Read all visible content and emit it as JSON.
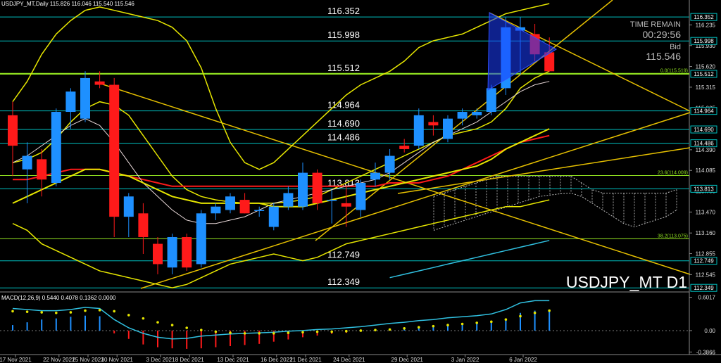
{
  "header": "USDJPY_MT,Daily  115.826 116.046 115.540 115.546",
  "macd_header": "MACD(12,26,9) 0.5440 0.4078 0.1362 0.0000",
  "panel": {
    "time_label": "TIME REMAIN",
    "time_value": "00:29:56",
    "bid_label": "Bid",
    "bid_value": "115.546"
  },
  "symbol_label": "USDJPY_MT D1",
  "colors": {
    "bull": "#1e90ff",
    "bear": "#ff1a1a",
    "hline": "#00c0c0",
    "price_box": "#00c0c0",
    "bollinger": "#e6e600",
    "ma_red": "#ff1a1a",
    "ma_white": "#e8d8d8",
    "trendline": "#e6c000",
    "fib": "#90e020"
  },
  "chart_data": {
    "type": "candlestick",
    "y_range": [
      112.32,
      116.52
    ],
    "price_axis_ticks": [
      "116.235",
      "115.930",
      "115.620",
      "115.315",
      "115.005",
      "114.390",
      "114.085",
      "113.780",
      "113.470",
      "113.160",
      "112.855",
      "112.545"
    ],
    "x_tick_labels": [
      "17 Nov 2021",
      "22 Nov 2021",
      "25 Nov 2021",
      "30 Nov 2021",
      "3 Dec 2021",
      "8 Dec 2021",
      "13 Dec 2021",
      "16 Dec 2021",
      "21 Dec 2021",
      "24 Dec 2021",
      "29 Dec 2021",
      "3 Jan 2022",
      "6 Jan 2022"
    ],
    "horizontal_levels": [
      {
        "price": 116.352,
        "label": "116.352"
      },
      {
        "price": 115.998,
        "label": "115.998"
      },
      {
        "price": 115.512,
        "label": "115.512"
      },
      {
        "price": 114.964,
        "label": "114.964"
      },
      {
        "price": 114.69,
        "label": "114.690"
      },
      {
        "price": 114.486,
        "label": "114.486"
      },
      {
        "price": 113.813,
        "label": "113.813"
      },
      {
        "price": 112.749,
        "label": "112.749"
      },
      {
        "price": 112.349,
        "label": "112.349"
      }
    ],
    "fib_levels": [
      {
        "price": 115.519,
        "label": "0.0(115.519)"
      },
      {
        "price": 114.009,
        "label": "23.6(114.009)"
      },
      {
        "price": 113.075,
        "label": "38.2(113.075)"
      }
    ],
    "candles": [
      {
        "o": 114.9,
        "h": 115.1,
        "l": 114.0,
        "c": 114.45
      },
      {
        "o": 114.1,
        "h": 114.5,
        "l": 113.6,
        "c": 114.3
      },
      {
        "o": 114.25,
        "h": 114.4,
        "l": 113.7,
        "c": 113.95
      },
      {
        "o": 113.9,
        "h": 115.0,
        "l": 113.85,
        "c": 114.95
      },
      {
        "o": 114.95,
        "h": 115.3,
        "l": 114.7,
        "c": 115.25
      },
      {
        "o": 114.85,
        "h": 115.55,
        "l": 114.8,
        "c": 115.45
      },
      {
        "o": 115.4,
        "h": 115.55,
        "l": 115.3,
        "c": 115.35
      },
      {
        "o": 115.35,
        "h": 115.45,
        "l": 113.1,
        "c": 113.4
      },
      {
        "o": 113.4,
        "h": 113.75,
        "l": 113.1,
        "c": 113.7
      },
      {
        "o": 113.45,
        "h": 113.6,
        "l": 112.85,
        "c": 113.1
      },
      {
        "o": 113.0,
        "h": 113.1,
        "l": 112.55,
        "c": 112.7
      },
      {
        "o": 112.65,
        "h": 113.15,
        "l": 112.55,
        "c": 113.1
      },
      {
        "o": 113.1,
        "h": 113.15,
        "l": 112.6,
        "c": 112.65
      },
      {
        "o": 112.7,
        "h": 113.5,
        "l": 112.65,
        "c": 113.45
      },
      {
        "o": 113.45,
        "h": 113.6,
        "l": 113.35,
        "c": 113.55
      },
      {
        "o": 113.5,
        "h": 113.75,
        "l": 113.45,
        "c": 113.7
      },
      {
        "o": 113.65,
        "h": 113.75,
        "l": 113.45,
        "c": 113.45
      },
      {
        "o": 113.5,
        "h": 113.55,
        "l": 113.4,
        "c": 113.5
      },
      {
        "o": 113.25,
        "h": 113.6,
        "l": 113.2,
        "c": 113.55
      },
      {
        "o": 113.55,
        "h": 113.85,
        "l": 113.5,
        "c": 113.75
      },
      {
        "o": 113.55,
        "h": 114.2,
        "l": 113.5,
        "c": 114.05
      },
      {
        "o": 114.05,
        "h": 114.1,
        "l": 113.5,
        "c": 113.6
      },
      {
        "o": 113.65,
        "h": 113.8,
        "l": 113.3,
        "c": 113.65
      },
      {
        "o": 113.6,
        "h": 113.85,
        "l": 113.25,
        "c": 113.55
      },
      {
        "o": 113.5,
        "h": 113.95,
        "l": 113.4,
        "c": 113.9
      },
      {
        "o": 113.95,
        "h": 114.2,
        "l": 113.85,
        "c": 114.05
      },
      {
        "o": 114.05,
        "h": 114.4,
        "l": 113.95,
        "c": 114.3
      },
      {
        "o": 114.45,
        "h": 114.55,
        "l": 114.35,
        "c": 114.4
      },
      {
        "o": 114.45,
        "h": 115.0,
        "l": 114.4,
        "c": 114.9
      },
      {
        "o": 114.8,
        "h": 114.9,
        "l": 114.6,
        "c": 114.75
      },
      {
        "o": 114.55,
        "h": 114.9,
        "l": 114.5,
        "c": 114.85
      },
      {
        "o": 114.85,
        "h": 115.0,
        "l": 114.75,
        "c": 114.95
      },
      {
        "o": 114.9,
        "h": 115.0,
        "l": 114.85,
        "c": 114.95
      },
      {
        "o": 114.95,
        "h": 115.35,
        "l": 114.9,
        "c": 115.3
      },
      {
        "o": 115.3,
        "h": 116.35,
        "l": 115.2,
        "c": 116.2
      },
      {
        "o": 116.15,
        "h": 116.35,
        "l": 115.5,
        "c": 116.2
      },
      {
        "o": 116.1,
        "h": 116.25,
        "l": 115.7,
        "c": 115.8
      },
      {
        "o": 115.83,
        "h": 116.05,
        "l": 115.54,
        "c": 115.55
      }
    ],
    "indicators": [
      "Bollinger Bands",
      "moving averages",
      "Ichimoku cloud",
      "trend lines",
      "triangle pattern",
      "Fibonacci retracement"
    ],
    "macd": {
      "label": "MACD(12,26,9)",
      "axis_ticks": [
        "0.6017",
        "0.00",
        "-0.3866"
      ],
      "y_range": [
        -0.42,
        0.66
      ],
      "histogram": [
        0.1,
        0.15,
        0.2,
        0.22,
        0.25,
        0.27,
        0.26,
        -0.05,
        -0.15,
        -0.25,
        -0.3,
        -0.32,
        -0.33,
        -0.32,
        -0.3,
        -0.28,
        -0.26,
        -0.24,
        -0.2,
        -0.16,
        -0.12,
        -0.09,
        -0.06,
        -0.04,
        -0.02,
        0.0,
        0.02,
        0.04,
        0.06,
        0.08,
        0.1,
        0.12,
        0.14,
        0.16,
        0.22,
        0.32,
        0.36,
        0.38
      ],
      "signal": [
        0.35,
        0.34,
        0.33,
        0.32,
        0.33,
        0.36,
        0.37,
        0.35,
        0.28,
        0.22,
        0.15,
        0.1,
        0.05,
        0.01,
        -0.02,
        -0.04,
        -0.05,
        -0.05,
        -0.05,
        -0.04,
        -0.03,
        -0.02,
        -0.02,
        -0.01,
        0.0,
        0.01,
        0.02,
        0.04,
        0.06,
        0.08,
        0.1,
        0.12,
        0.14,
        0.16,
        0.2,
        0.26,
        0.32,
        0.36
      ],
      "macd_line": [
        0.4,
        0.38,
        0.36,
        0.36,
        0.38,
        0.42,
        0.4,
        0.2,
        0.05,
        -0.05,
        -0.12,
        -0.15,
        -0.14,
        -0.1,
        -0.08,
        -0.06,
        -0.05,
        -0.04,
        -0.03,
        -0.01,
        0.0,
        0.02,
        0.03,
        0.05,
        0.07,
        0.1,
        0.13,
        0.15,
        0.18,
        0.2,
        0.23,
        0.25,
        0.27,
        0.3,
        0.38,
        0.5,
        0.54,
        0.54
      ]
    }
  }
}
